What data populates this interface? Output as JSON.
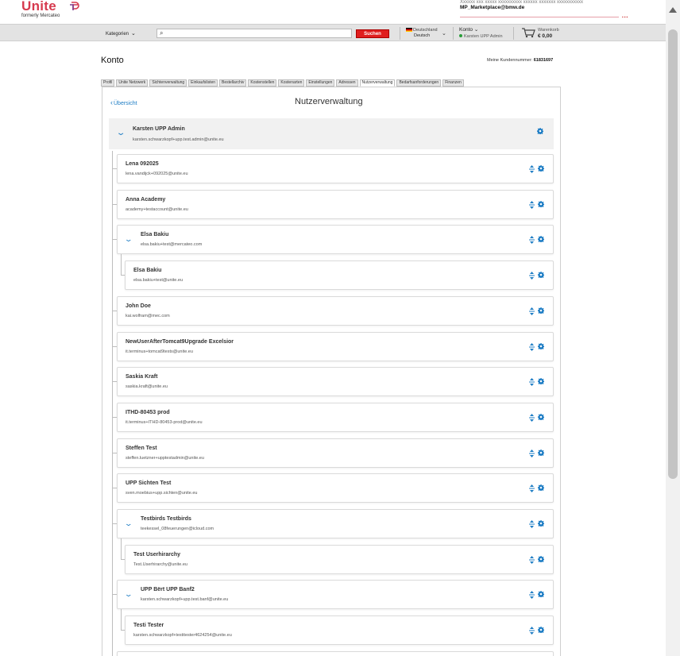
{
  "header": {
    "logo_text": "Unite",
    "logo_sub": "formerly Mercateo",
    "user_line1": "Xxxxxx xxx xxxxx xxxxxxxxxx xxxxxx xxxxxxx xxxxxxxxxxx",
    "user_email": "MP_Marketplace@bmw.de",
    "categories_label": "Kategorien",
    "search_placeholder": "",
    "search_button": "Suchen",
    "country_label": "Deutschland",
    "language_label": "Deutsch",
    "account_label": "Konto",
    "account_user": "Karsten UPP Admin",
    "cart_label": "Warenkorb",
    "cart_value": "€ 0,00",
    "brand_color": "#d63a4e"
  },
  "page": {
    "title": "Konto",
    "customer_number_label": "Meine Kundennummer:",
    "customer_number": "61831697",
    "tabs": [
      {
        "label": "Profil"
      },
      {
        "label": "Unite Netzwerk"
      },
      {
        "label": "Sichtenverwaltung"
      },
      {
        "label": "Einkaufslisten"
      },
      {
        "label": "Bestellarchiv"
      },
      {
        "label": "Kostenstellen"
      },
      {
        "label": "Kostenarten"
      },
      {
        "label": "Einstellungen"
      },
      {
        "label": "Adressen"
      },
      {
        "label": "Nutzerverwaltung",
        "active": true
      },
      {
        "label": "Bedarfsanforderungen"
      },
      {
        "label": "Finanzen"
      }
    ],
    "back_label": "Übersicht",
    "section_title": "Nutzerverwaltung"
  },
  "root_user": {
    "name": "Karsten UPP Admin",
    "email": "karsten.schwarzkopf+upp.test.admin@unite.eu"
  },
  "users": [
    {
      "name": "Lena 092025",
      "email": "lena.vandijck+092025@unite.eu",
      "level": 1,
      "expandable": false
    },
    {
      "name": "Anna Academy",
      "email": "academy+testaccount@unite.eu",
      "level": 1,
      "expandable": false
    },
    {
      "name": "Elsa Bakiu",
      "email": "elsa.bakiu+test@mercateo.com",
      "level": 1,
      "expandable": true
    },
    {
      "name": "Elsa Bakiu",
      "email": "elsa.bakiu+test@unite.eu",
      "level": 2,
      "expandable": false
    },
    {
      "name": "John Doe",
      "email": "kai.wolfram@mec.com",
      "level": 1,
      "expandable": false
    },
    {
      "name": "NewUserAfterTomcat9Upgrade Excelsior",
      "email": "it.terminus+tomcat9tests@unite.eu",
      "level": 1,
      "expandable": false
    },
    {
      "name": "Saskia Kraft",
      "email": "saskia.kraft@unite.eu",
      "level": 1,
      "expandable": false
    },
    {
      "name": "ITHD-80453 prod",
      "email": "it.terminus+ITHD-80453-prod@unite.eu",
      "level": 1,
      "expandable": false
    },
    {
      "name": "Steffen Test",
      "email": "steffen.luetzner+upptestadmin@unite.eu",
      "level": 1,
      "expandable": false
    },
    {
      "name": "UPP Sichten Test",
      "email": "sven.moebius+upp.sichten@unite.eu",
      "level": 1,
      "expandable": false
    },
    {
      "name": "Testbirds Testbirds",
      "email": "teekessel_08feuerungen@icloud.com",
      "level": 1,
      "expandable": true
    },
    {
      "name": "Test Userhirarchy",
      "email": "Test.Userhirarchy@unite.eu",
      "level": 2,
      "expandable": false
    },
    {
      "name": "UPP Bërt UPP Banf2",
      "email": "karsten.schwarzkopf+upp.test.banf@unite.eu",
      "level": 1,
      "expandable": true
    },
    {
      "name": "Testi Tester",
      "email": "karsten.schwarzkopf+testitester4624254@unite.eu",
      "level": 2,
      "expandable": false
    }
  ],
  "accent_color": "#1c7cc4"
}
